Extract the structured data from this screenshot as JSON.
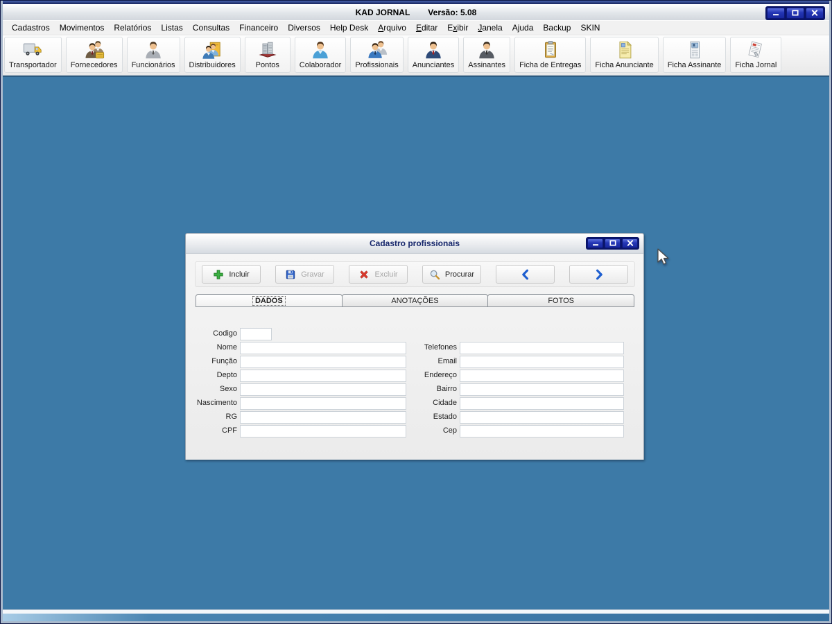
{
  "window": {
    "title": "KAD JORNAL",
    "version": "Versão: 5.08",
    "controls": [
      "minimize",
      "maximize",
      "close"
    ]
  },
  "menu": {
    "items": [
      {
        "label": "Cadastros",
        "accesskey_index": -1
      },
      {
        "label": "Movimentos",
        "accesskey_index": -1
      },
      {
        "label": "Relatórios",
        "accesskey_index": -1
      },
      {
        "label": "Listas",
        "accesskey_index": -1
      },
      {
        "label": "Consultas",
        "accesskey_index": -1
      },
      {
        "label": "Financeiro",
        "accesskey_index": -1
      },
      {
        "label": "Diversos",
        "accesskey_index": -1
      },
      {
        "label": "Help Desk",
        "accesskey_index": -1
      },
      {
        "label": "Arquivo",
        "accesskey_index": 0
      },
      {
        "label": "Editar",
        "accesskey_index": 0
      },
      {
        "label": "Exibir",
        "accesskey_index": 1
      },
      {
        "label": "Janela",
        "accesskey_index": 0
      },
      {
        "label": "Ajuda",
        "accesskey_index": -1
      },
      {
        "label": "Backup",
        "accesskey_index": -1
      },
      {
        "label": "SKIN",
        "accesskey_index": -1
      }
    ]
  },
  "toolbar": {
    "buttons": [
      {
        "label": "Transportador",
        "icon": "truck-icon"
      },
      {
        "label": "Fornecedores",
        "icon": "suppliers-icon"
      },
      {
        "label": "Funcionários",
        "icon": "employee-icon"
      },
      {
        "label": "Distribuidores",
        "icon": "distributors-icon"
      },
      {
        "label": "Pontos",
        "icon": "building-icon"
      },
      {
        "label": "Colaborador",
        "icon": "collaborator-icon"
      },
      {
        "label": "Profissionais",
        "icon": "professionals-icon"
      },
      {
        "label": "Anunciantes",
        "icon": "advertiser-icon"
      },
      {
        "label": "Assinantes",
        "icon": "subscriber-icon"
      },
      {
        "label": "Ficha de Entregas",
        "icon": "clipboard-icon"
      },
      {
        "label": "Ficha Anunciante",
        "icon": "advertiser-sheet-icon"
      },
      {
        "label": "Ficha Assinante",
        "icon": "subscriber-sheet-icon"
      },
      {
        "label": "Ficha Jornal",
        "icon": "newspaper-icon"
      }
    ]
  },
  "child_window": {
    "title": "Cadastro profissionais",
    "controls": [
      "minimize",
      "maximize",
      "close"
    ],
    "toolbar_buttons": [
      {
        "label": "Incluir",
        "icon": "add-icon",
        "enabled": true
      },
      {
        "label": "Gravar",
        "icon": "save-icon",
        "enabled": false
      },
      {
        "label": "Excluir",
        "icon": "delete-icon",
        "enabled": false
      },
      {
        "label": "Procurar",
        "icon": "search-icon",
        "enabled": true
      },
      {
        "label": "",
        "icon": "chevron-left-icon",
        "enabled": true
      },
      {
        "label": "",
        "icon": "chevron-right-icon",
        "enabled": true
      }
    ],
    "tabs": [
      {
        "label": "DADOS",
        "active": true
      },
      {
        "label": "ANOTAÇÕES",
        "active": false
      },
      {
        "label": "FOTOS",
        "active": false
      }
    ],
    "form": {
      "left_fields": [
        {
          "label": "Codigo",
          "value": "",
          "size": "small"
        },
        {
          "label": "Nome",
          "value": ""
        },
        {
          "label": "Função",
          "value": ""
        },
        {
          "label": "Depto",
          "value": ""
        },
        {
          "label": "Sexo",
          "value": ""
        },
        {
          "label": "Nascimento",
          "value": ""
        },
        {
          "label": "RG",
          "value": ""
        },
        {
          "label": "CPF",
          "value": ""
        }
      ],
      "right_fields": [
        {
          "label": "Telefones",
          "value": ""
        },
        {
          "label": "Email",
          "value": ""
        },
        {
          "label": "Endereço",
          "value": ""
        },
        {
          "label": "Bairro",
          "value": ""
        },
        {
          "label": "Cidade",
          "value": ""
        },
        {
          "label": "Estado",
          "value": ""
        },
        {
          "label": "Cep",
          "value": ""
        }
      ]
    }
  },
  "colors": {
    "mdi_background": "#3d7aa7",
    "control_button_blue": "#2335b4",
    "accent_chevron_blue": "#1e5fd0",
    "include_green": "#3cb043",
    "delete_red": "#d8382c",
    "disabled_text": "#a6a6a6",
    "child_title_text": "#16266b"
  }
}
